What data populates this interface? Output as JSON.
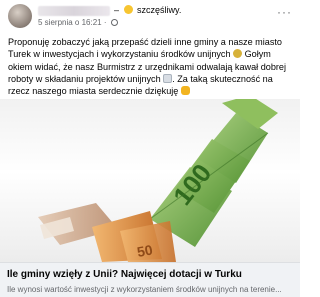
{
  "post": {
    "author": "",
    "feeling_prefix": "–",
    "feeling_text": "szczęśliwy.",
    "date": "5 sierpnia o 16:21",
    "date_separator": "·",
    "more_label": "···",
    "body": {
      "line1": "Proponuję zobaczyć jaką przepaść dzieli inne gminy a nasze miasto Turek w inwestycjach i wykorzystaniu środków unijnych",
      "line2": "Gołym okiem widać, że nasz Burmistrz z urzędnikami odwalają kawał dobrej roboty w składaniu projektów unijnych",
      "line3": "Za taką skuteczność na rzecz naszego miasta serdecznie dziękuję",
      "icons": [
        "smiling-face-icon",
        "memo-icon",
        "thumbs-up-icon"
      ]
    },
    "link_preview": {
      "title": "Ile gminy wzięły z Unii? Najwięcej dotacji w Turku",
      "description": "Ile wynosi wartość inwestycji z wykorzystaniem środków unijnych na terenie..."
    },
    "image": {
      "subject": "euro-banknote-arrow-image",
      "colors": {
        "note100": "#79b04a",
        "note50": "#d88a3e",
        "note10": "#c9a184"
      }
    }
  }
}
